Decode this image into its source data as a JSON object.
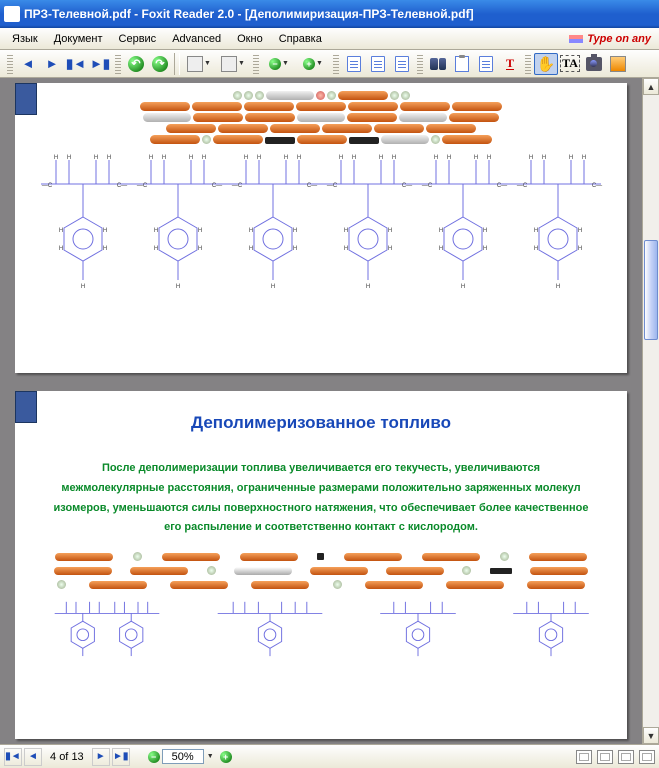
{
  "window": {
    "title_prefix": "ПРЗ-Телевной.pdf - Foxit Reader 2.0 - [Деполимиризация-ПРЗ-Телевной.pdf]"
  },
  "menu": {
    "items": [
      "Язык",
      "Документ",
      "Сервис",
      "Advanced",
      "Окно",
      "Справка"
    ],
    "typeon_label": "Type on any"
  },
  "toolbar_icons": {
    "prev": "prev-page",
    "next": "next-page",
    "first": "first-page",
    "last": "last-page",
    "rotate_ccw": "rotate-ccw",
    "undo": "undo",
    "refresh": "refresh",
    "zoom_out": "zoom-out",
    "zoom_in": "zoom-in",
    "page_actual": "actual-size",
    "page_fit": "fit-page",
    "page_width": "fit-width",
    "find": "find",
    "clipboard": "clipboard",
    "form": "form",
    "typewriter": "typewriter",
    "hand": "hand-tool",
    "select_text": "select-text",
    "snapshot": "snapshot",
    "misc": "misc"
  },
  "doc": {
    "page1": {},
    "page2": {
      "title": "Деполимеризованное топливо",
      "body": "После деполимеризации топлива увеличивается его текучесть, увеличиваются межмолекулярные расстояния, ограниченные размерами положительно заряженных молекул изомеров, уменьшаются силы поверхностного натяжения, что обеспечивает более качественное его распыление и соответственно контакт с кислородом."
    }
  },
  "status": {
    "page_current": "4",
    "page_sep": "of",
    "page_total": "13",
    "zoom": "50%"
  }
}
